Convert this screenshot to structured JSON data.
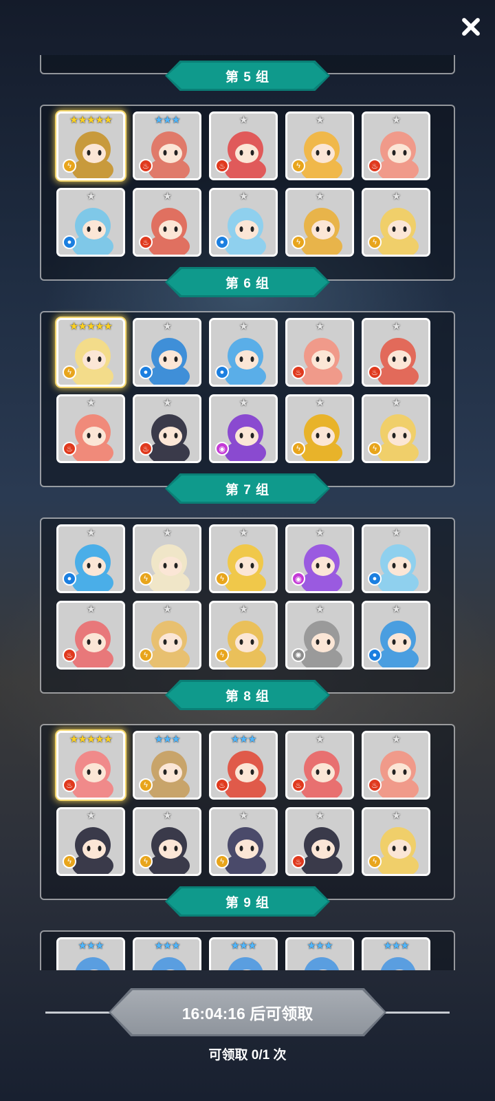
{
  "close_icon": "close-icon",
  "groups": [
    {
      "label": "第 5 组",
      "cards": [
        {
          "stars": "★★★★★",
          "tier": 5,
          "element": "thunder",
          "char": "golden-book",
          "color": "#c89a3c"
        },
        {
          "stars": "★★★",
          "tier": 3,
          "element": "fire",
          "char": "queen",
          "color": "#e07a6a"
        },
        {
          "stars": "★",
          "tier": 1,
          "element": "fire",
          "char": "flower-monster",
          "color": "#e05a5a"
        },
        {
          "stars": "★",
          "tier": 1,
          "element": "thunder",
          "char": "skull",
          "color": "#f0b84a"
        },
        {
          "stars": "★",
          "tier": 1,
          "element": "fire",
          "char": "red-hat-girl",
          "color": "#f09a8a"
        },
        {
          "stars": "★",
          "tier": 1,
          "element": "water",
          "char": "cat-girl",
          "color": "#7fc8e8"
        },
        {
          "stars": "★",
          "tier": 1,
          "element": "fire",
          "char": "knight",
          "color": "#e07060"
        },
        {
          "stars": "★",
          "tier": 1,
          "element": "water",
          "char": "frost-girl",
          "color": "#8fd0ee"
        },
        {
          "stars": "★",
          "tier": 1,
          "element": "thunder",
          "char": "pharaoh",
          "color": "#e8b44a"
        },
        {
          "stars": "★",
          "tier": 1,
          "element": "thunder",
          "char": "armor",
          "color": "#f0cf6a"
        }
      ]
    },
    {
      "label": "第 6 组",
      "cards": [
        {
          "stars": "★★★★★",
          "tier": 5,
          "element": "thunder",
          "char": "blonde-goddess",
          "color": "#f3dc8a"
        },
        {
          "stars": "★",
          "tier": 1,
          "element": "water",
          "char": "coral-monster",
          "color": "#3f8fd8"
        },
        {
          "stars": "★",
          "tier": 1,
          "element": "water",
          "char": "blue-skull",
          "color": "#5aaee8"
        },
        {
          "stars": "★",
          "tier": 1,
          "element": "fire",
          "char": "red-hat-girl",
          "color": "#f09a8a"
        },
        {
          "stars": "★",
          "tier": 1,
          "element": "fire",
          "char": "octopus",
          "color": "#e26a5a"
        },
        {
          "stars": "★",
          "tier": 1,
          "element": "fire",
          "char": "horn-girl",
          "color": "#f08a7a"
        },
        {
          "stars": "★",
          "tier": 1,
          "element": "fire",
          "char": "card-queen",
          "color": "#3a3a4a"
        },
        {
          "stars": "★",
          "tier": 1,
          "element": "dark",
          "char": "purple-totem",
          "color": "#8a4ad0"
        },
        {
          "stars": "★",
          "tier": 1,
          "element": "thunder",
          "char": "treasure-chest",
          "color": "#e8b32a"
        },
        {
          "stars": "★",
          "tier": 1,
          "element": "thunder",
          "char": "armor",
          "color": "#f0cf6a"
        }
      ]
    },
    {
      "label": "第 7 组",
      "cards": [
        {
          "stars": "★",
          "tier": 1,
          "element": "water",
          "char": "blue-furball",
          "color": "#4aaee8"
        },
        {
          "stars": "★",
          "tier": 1,
          "element": "thunder",
          "char": "mummy",
          "color": "#f0e6c8"
        },
        {
          "stars": "★",
          "tier": 1,
          "element": "thunder",
          "char": "sunflower",
          "color": "#f0c84a"
        },
        {
          "stars": "★",
          "tier": 1,
          "element": "dark",
          "char": "purple-dragon",
          "color": "#9a5ae0"
        },
        {
          "stars": "★",
          "tier": 1,
          "element": "water",
          "char": "ice-girl",
          "color": "#8fd0ee"
        },
        {
          "stars": "★",
          "tier": 1,
          "element": "fire",
          "char": "red-moai",
          "color": "#e8787a"
        },
        {
          "stars": "★",
          "tier": 1,
          "element": "thunder",
          "char": "gold-moai",
          "color": "#e8c070"
        },
        {
          "stars": "★",
          "tier": 1,
          "element": "thunder",
          "char": "gold-totem",
          "color": "#eac05a"
        },
        {
          "stars": "★",
          "tier": 1,
          "element": "light",
          "char": "gray-totem",
          "color": "#9a9a9a"
        },
        {
          "stars": "★",
          "tier": 1,
          "element": "water",
          "char": "ice-armor",
          "color": "#4a9ee0"
        }
      ]
    },
    {
      "label": "第 8 组",
      "cards": [
        {
          "stars": "★★★★★",
          "tier": 5,
          "element": "fire",
          "char": "pink-warrior",
          "color": "#f08a8a"
        },
        {
          "stars": "★★★",
          "tier": 3,
          "element": "thunder",
          "char": "old-king",
          "color": "#c8a46a"
        },
        {
          "stars": "★★★",
          "tier": 3,
          "element": "fire",
          "char": "clock",
          "color": "#e05a4a"
        },
        {
          "stars": "★",
          "tier": 1,
          "element": "fire",
          "char": "pink-skull",
          "color": "#e87070"
        },
        {
          "stars": "★",
          "tier": 1,
          "element": "fire",
          "char": "red-hat-girl",
          "color": "#f09a8a"
        },
        {
          "stars": "★",
          "tier": 1,
          "element": "thunder",
          "char": "dark-hair-girl",
          "color": "#3a3a4a"
        },
        {
          "stars": "★",
          "tier": 1,
          "element": "thunder",
          "char": "dark-hair-girl",
          "color": "#3a3a4a"
        },
        {
          "stars": "★",
          "tier": 1,
          "element": "thunder",
          "char": "witch",
          "color": "#4a4a6a"
        },
        {
          "stars": "★",
          "tier": 1,
          "element": "fire",
          "char": "card-queen",
          "color": "#3a3a4a"
        },
        {
          "stars": "★",
          "tier": 1,
          "element": "thunder",
          "char": "armor",
          "color": "#f0cf6a"
        }
      ]
    },
    {
      "label": "第 9 组",
      "cards": [
        {
          "stars": "★★★",
          "tier": 3,
          "element": "water",
          "char": "unknown",
          "color": "#5a9ee0"
        },
        {
          "stars": "★★★",
          "tier": 3,
          "element": "water",
          "char": "unknown",
          "color": "#5a9ee0"
        },
        {
          "stars": "★★★",
          "tier": 3,
          "element": "water",
          "char": "unknown",
          "color": "#5a9ee0"
        },
        {
          "stars": "★★★",
          "tier": 3,
          "element": "water",
          "char": "unknown",
          "color": "#5a9ee0"
        },
        {
          "stars": "★★★",
          "tier": 3,
          "element": "water",
          "char": "unknown",
          "color": "#5a9ee0"
        }
      ]
    }
  ],
  "footer": {
    "claim_label": "16:04:16 后可领取",
    "count_label": "可领取 0/1 次"
  }
}
